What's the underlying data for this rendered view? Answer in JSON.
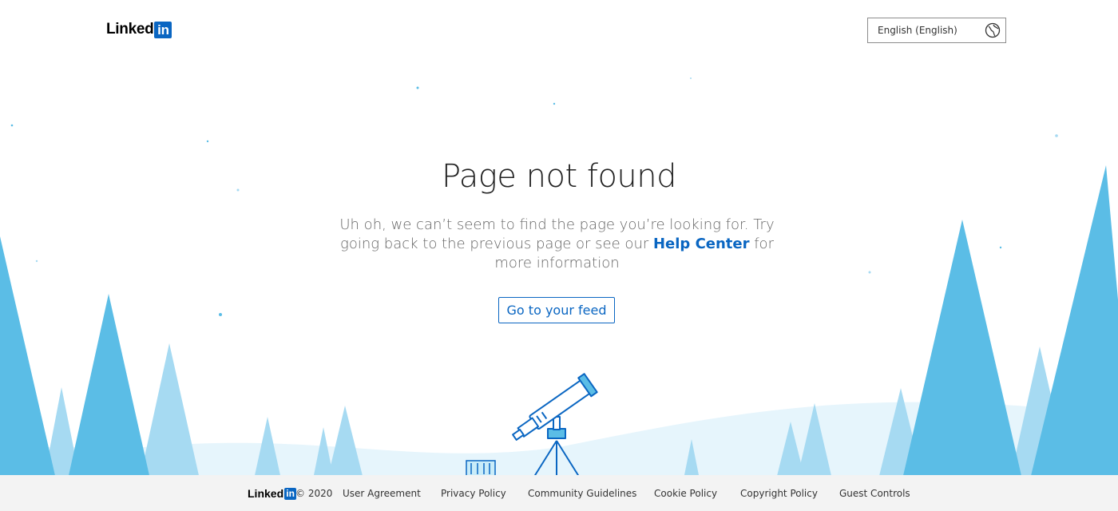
{
  "header": {
    "logo_text": "Linked",
    "logo_in": "in",
    "language_select": {
      "value": "English (English)",
      "icon": "globe-icon"
    }
  },
  "main": {
    "title": "Page not found",
    "message_before": "Uh oh, we can’t seem to find the page you’re looking for. Try going back to the previous page or see our ",
    "help_link": "Help Center",
    "message_after": " for more information",
    "feed_button": "Go to your feed"
  },
  "illustration": {
    "scene": "snowy forest with telescope",
    "icons": [
      "telescope-icon",
      "tree-icon"
    ]
  },
  "footer": {
    "logo_text": "Linked",
    "logo_in": "in",
    "copyright": "© 2020",
    "links": [
      "User Agreement",
      "Privacy Policy",
      "Community Guidelines",
      "Cookie Policy",
      "Copyright Policy",
      "Guest Controls"
    ]
  },
  "colors": {
    "brand_blue": "#0a66c2",
    "tree_dark": "#5bbde6",
    "tree_light": "#a6daf2",
    "hill": "#e6f5fc",
    "footer_bg": "#f3f3f3"
  }
}
